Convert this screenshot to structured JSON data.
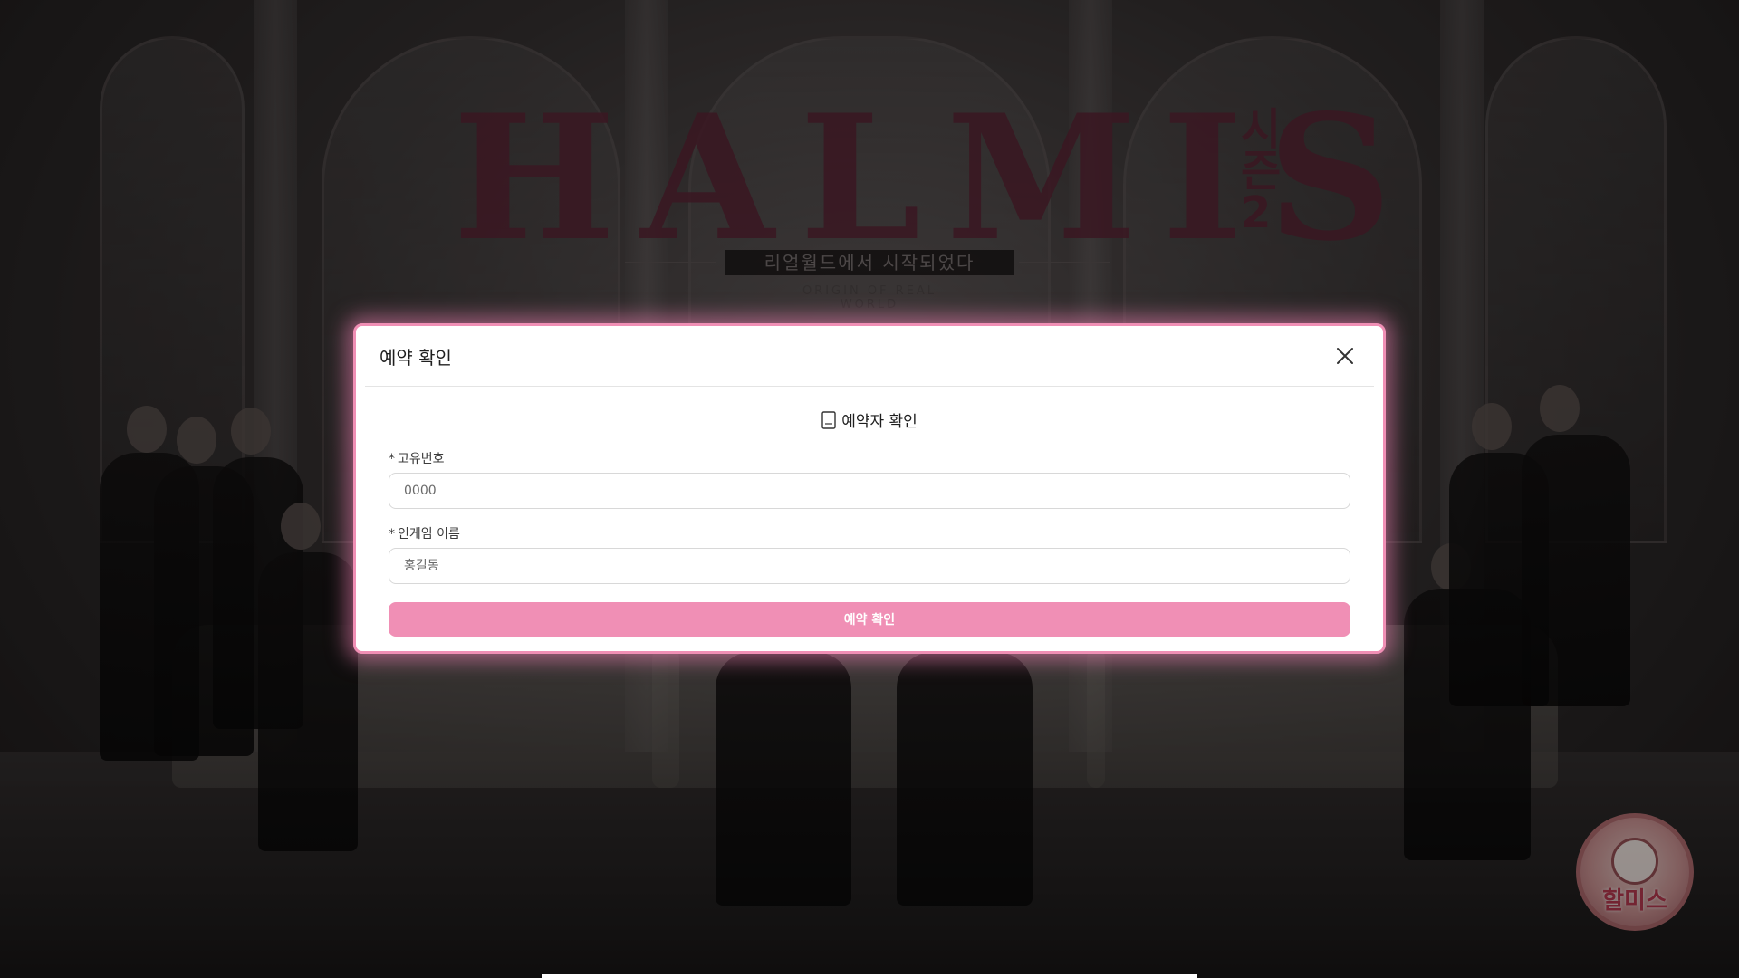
{
  "background": {
    "logo_main": "HALMIS",
    "logo_side": "시즌2",
    "tagline": "리얼월드에서 시작되었다",
    "sub_tagline": "ORIGIN OF REAL WORLD"
  },
  "badge": {
    "label": "할미스"
  },
  "modal": {
    "title": "예약 확인",
    "section_title": "예약자 확인",
    "fields": [
      {
        "required_mark": "*",
        "label": "고유번호",
        "placeholder": "0000",
        "value": ""
      },
      {
        "required_mark": "*",
        "label": "인게임 이름",
        "placeholder": "홍길동",
        "value": ""
      }
    ],
    "submit_label": "예약 확인"
  },
  "colors": {
    "accent": "#f08fb5",
    "logo": "#6a2b3e"
  },
  "icons": {
    "close": "close-icon",
    "section": "document-icon"
  }
}
